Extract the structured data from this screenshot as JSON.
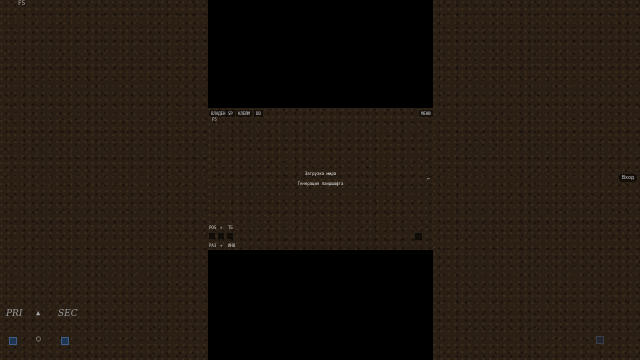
{
  "topleft_label": "F5",
  "game": {
    "top_buttons": [
      "ВЛАДЕН",
      "SP",
      "КЛЕЙМ",
      "DB",
      "МЕНЮ"
    ],
    "sub_label": "F5",
    "messages": [
      "Загрузка мира",
      "Генерация ландшафта"
    ],
    "hotbar": {
      "row1": [
        "POS",
        "×",
        "ТБ"
      ],
      "row3": [
        "РАЗ",
        "+",
        "ИНВ"
      ]
    },
    "right_marker": "←"
  },
  "right_overlay": "Вход",
  "bottom_left": {
    "pri": "PRI",
    "sec": "SEC",
    "up_arrow": "▲",
    "circle": "○"
  },
  "colors": {
    "dirt": "#2a1f15",
    "button_blue": "#1e3553"
  }
}
